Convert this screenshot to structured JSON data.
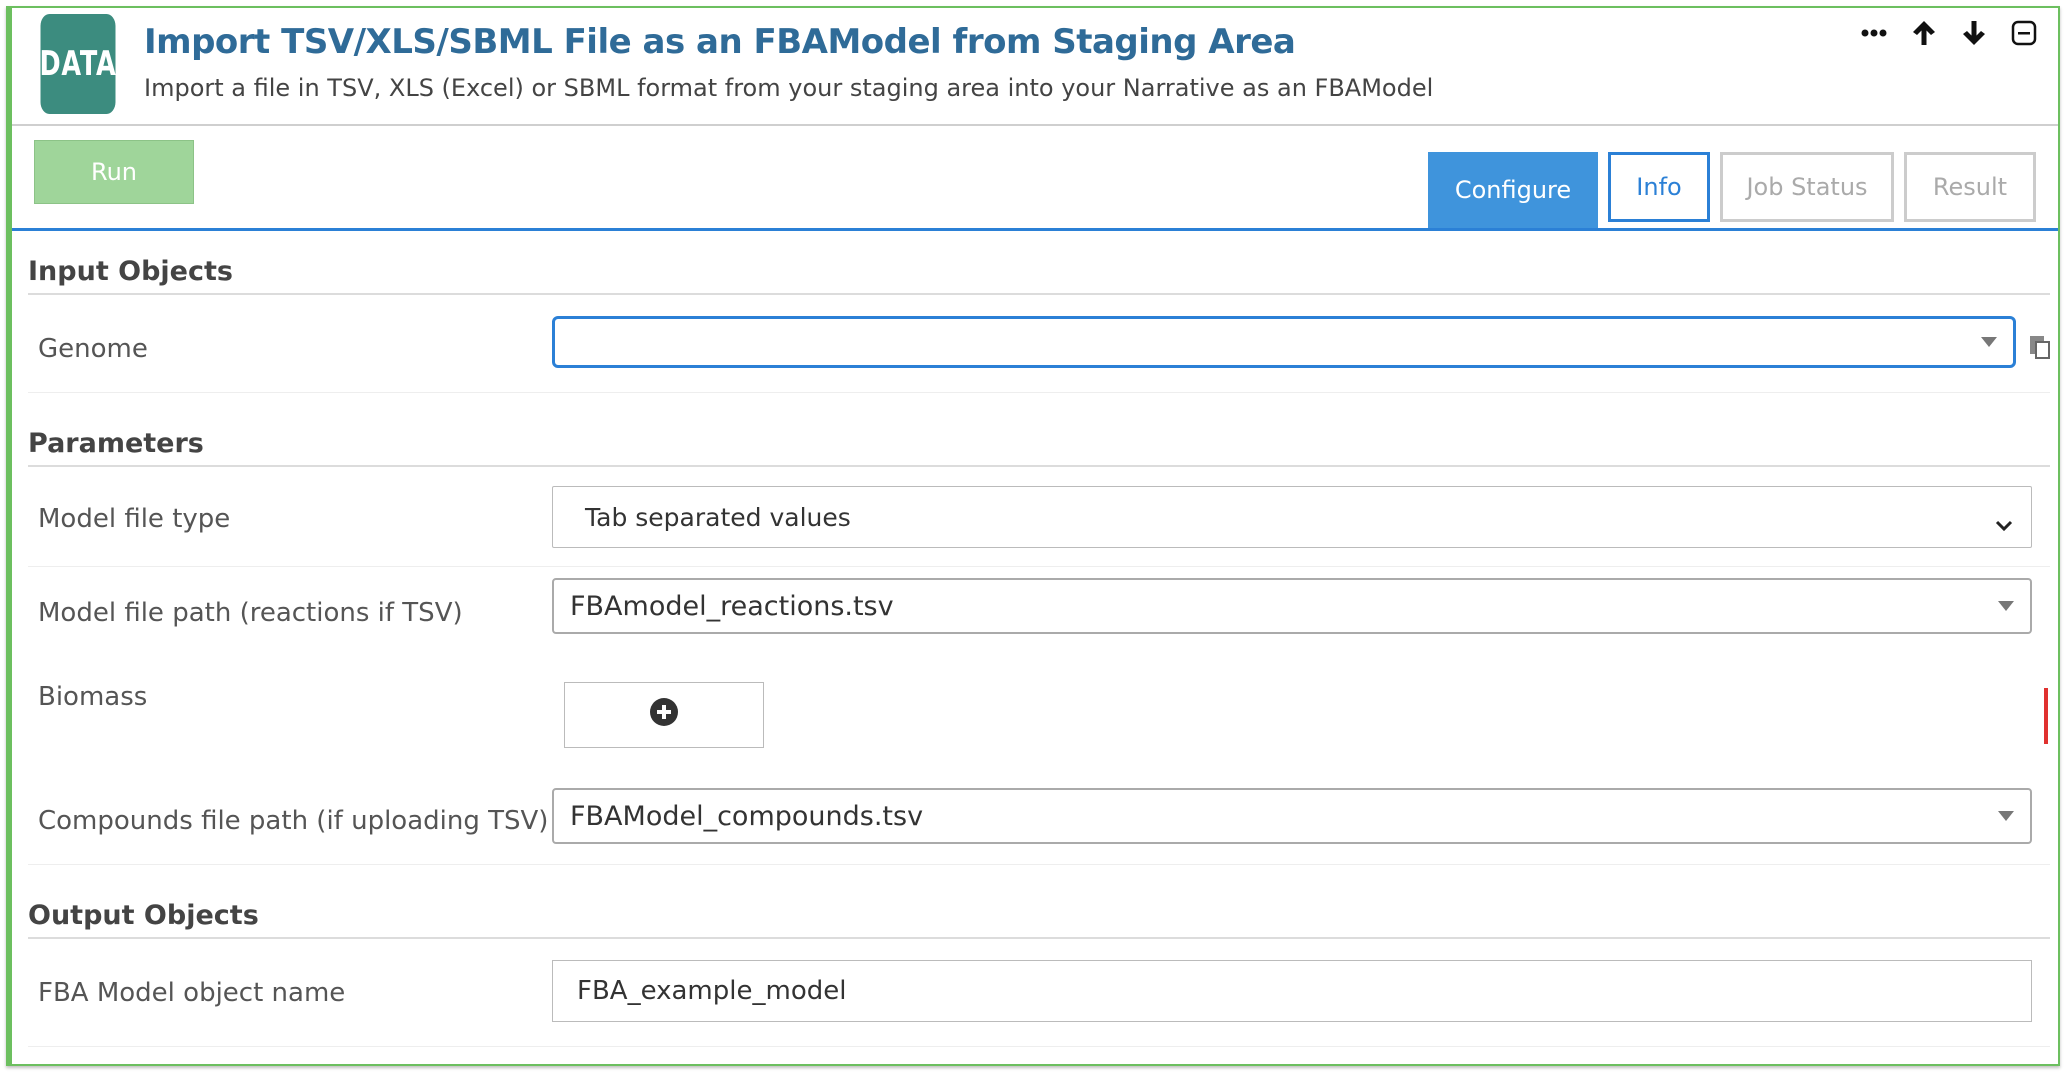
{
  "header": {
    "badge": "DATA",
    "title": "Import TSV/XLS/SBML File as an FBAModel from Staging Area",
    "subtitle": "Import a file in TSV, XLS (Excel) or SBML format from your staging area into your Narrative as an FBAModel",
    "controls": [
      "ellipsis-icon",
      "arrow-up-icon",
      "arrow-down-icon",
      "collapse-icon"
    ]
  },
  "toolbar": {
    "run_label": "Run",
    "tabs": {
      "configure": "Configure",
      "info": "Info",
      "job_status": "Job Status",
      "result": "Result"
    }
  },
  "sections": {
    "input_objects": "Input Objects",
    "parameters": "Parameters",
    "output_objects": "Output Objects"
  },
  "fields": {
    "genome": {
      "label": "Genome",
      "value": ""
    },
    "model_file_type": {
      "label": "Model file type",
      "value": "Tab separated values"
    },
    "model_file_path": {
      "label": "Model file path (reactions if TSV)",
      "value": "FBAmodel_reactions.tsv"
    },
    "biomass": {
      "label": "Biomass"
    },
    "compounds_file_path": {
      "label": "Compounds file path (if uploading TSV)",
      "value": "FBAModel_compounds.tsv"
    },
    "fba_model_name": {
      "label": "FBA Model object name",
      "value": "FBA_example_model"
    }
  },
  "colors": {
    "accent": "#2b80d6",
    "cell_border": "#6cbf5f",
    "badge": "#3c8c7f",
    "run_button": "#9fd59a",
    "validation_marker": "#e0312f"
  }
}
